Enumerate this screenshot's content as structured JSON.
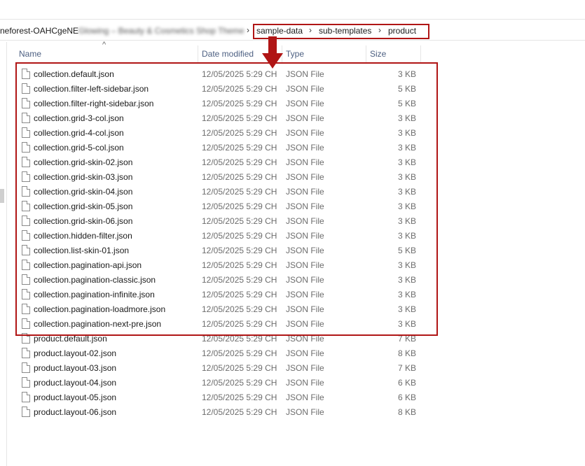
{
  "address_bar": {
    "partial_path": "neforest-OAHCgeNE",
    "blurred_path": "Glowing – Beauty & Cosmetics Shop Theme",
    "crumbs": [
      "sample-data",
      "sub-templates",
      "product"
    ],
    "separator": "›"
  },
  "columns": {
    "name": "Name",
    "date_modified": "Date modified",
    "type": "Type",
    "size": "Size",
    "sort_indicator": "^"
  },
  "files": [
    {
      "name": "collection.default.json",
      "date": "12/05/2025 5:29 CH",
      "type": "JSON File",
      "size": "3 KB"
    },
    {
      "name": "collection.filter-left-sidebar.json",
      "date": "12/05/2025 5:29 CH",
      "type": "JSON File",
      "size": "5 KB"
    },
    {
      "name": "collection.filter-right-sidebar.json",
      "date": "12/05/2025 5:29 CH",
      "type": "JSON File",
      "size": "5 KB"
    },
    {
      "name": "collection.grid-3-col.json",
      "date": "12/05/2025 5:29 CH",
      "type": "JSON File",
      "size": "3 KB"
    },
    {
      "name": "collection.grid-4-col.json",
      "date": "12/05/2025 5:29 CH",
      "type": "JSON File",
      "size": "3 KB"
    },
    {
      "name": "collection.grid-5-col.json",
      "date": "12/05/2025 5:29 CH",
      "type": "JSON File",
      "size": "3 KB"
    },
    {
      "name": "collection.grid-skin-02.json",
      "date": "12/05/2025 5:29 CH",
      "type": "JSON File",
      "size": "3 KB"
    },
    {
      "name": "collection.grid-skin-03.json",
      "date": "12/05/2025 5:29 CH",
      "type": "JSON File",
      "size": "3 KB"
    },
    {
      "name": "collection.grid-skin-04.json",
      "date": "12/05/2025 5:29 CH",
      "type": "JSON File",
      "size": "3 KB"
    },
    {
      "name": "collection.grid-skin-05.json",
      "date": "12/05/2025 5:29 CH",
      "type": "JSON File",
      "size": "3 KB"
    },
    {
      "name": "collection.grid-skin-06.json",
      "date": "12/05/2025 5:29 CH",
      "type": "JSON File",
      "size": "3 KB"
    },
    {
      "name": "collection.hidden-filter.json",
      "date": "12/05/2025 5:29 CH",
      "type": "JSON File",
      "size": "3 KB"
    },
    {
      "name": "collection.list-skin-01.json",
      "date": "12/05/2025 5:29 CH",
      "type": "JSON File",
      "size": "5 KB"
    },
    {
      "name": "collection.pagination-api.json",
      "date": "12/05/2025 5:29 CH",
      "type": "JSON File",
      "size": "3 KB"
    },
    {
      "name": "collection.pagination-classic.json",
      "date": "12/05/2025 5:29 CH",
      "type": "JSON File",
      "size": "3 KB"
    },
    {
      "name": "collection.pagination-infinite.json",
      "date": "12/05/2025 5:29 CH",
      "type": "JSON File",
      "size": "3 KB"
    },
    {
      "name": "collection.pagination-loadmore.json",
      "date": "12/05/2025 5:29 CH",
      "type": "JSON File",
      "size": "3 KB"
    },
    {
      "name": "collection.pagination-next-pre.json",
      "date": "12/05/2025 5:29 CH",
      "type": "JSON File",
      "size": "3 KB"
    },
    {
      "name": "product.default.json",
      "date": "12/05/2025 5:29 CH",
      "type": "JSON File",
      "size": "7 KB"
    },
    {
      "name": "product.layout-02.json",
      "date": "12/05/2025 5:29 CH",
      "type": "JSON File",
      "size": "8 KB"
    },
    {
      "name": "product.layout-03.json",
      "date": "12/05/2025 5:29 CH",
      "type": "JSON File",
      "size": "7 KB"
    },
    {
      "name": "product.layout-04.json",
      "date": "12/05/2025 5:29 CH",
      "type": "JSON File",
      "size": "6 KB"
    },
    {
      "name": "product.layout-05.json",
      "date": "12/05/2025 5:29 CH",
      "type": "JSON File",
      "size": "6 KB"
    },
    {
      "name": "product.layout-06.json",
      "date": "12/05/2025 5:29 CH",
      "type": "JSON File",
      "size": "8 KB"
    }
  ],
  "colors": {
    "annotation_red": "#b01515",
    "header_text": "#4d6082",
    "secondary_text": "#6d6d6d"
  },
  "icons": {
    "file": "file-icon",
    "arrow": "arrow-down-icon",
    "separator": "chevron-right-icon"
  }
}
